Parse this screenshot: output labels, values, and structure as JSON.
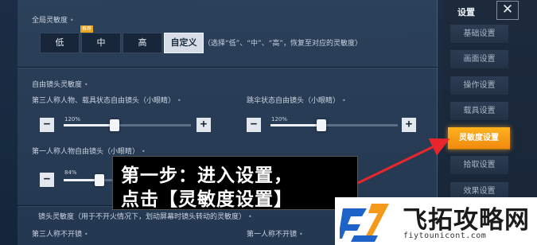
{
  "global_sensitivity": {
    "title": "全局灵敏度",
    "presets": [
      "低",
      "中",
      "高",
      "自定义"
    ],
    "recommend_badge": "推荐",
    "selected": "自定义",
    "note": "（选择“低”、“中”、“高”，恢复至对应的灵敏度）"
  },
  "free_look_sensitivity": {
    "title": "自由镜头灵敏度",
    "rows": [
      {
        "label": "第三人称人物、载具状态自由镜头（小眼睛）",
        "value_text": "120%",
        "value": 120
      },
      {
        "label": "跳伞状态自由镜头（小眼睛）",
        "value_text": "120%",
        "value": 120
      },
      {
        "label": "第一人称人物自由镜头（小眼睛）",
        "value_text": "84%",
        "value": 84
      }
    ]
  },
  "lens_sensitivity": {
    "title": "镜头灵敏度（用于不开火情况下，划动屏幕时镜头转动的灵敏度）",
    "items": [
      "第三人称不开镜",
      "第一人称不开镜"
    ]
  },
  "sidebar": {
    "title": "设置",
    "close_symbol": "✕",
    "items": [
      "基础设置",
      "画面设置",
      "操作设置",
      "载具设置",
      "灵敏度设置",
      "拾取设置",
      "效果设置"
    ],
    "active": "灵敏度设置"
  },
  "annotation": {
    "line1": "第一步：进入设置，",
    "line2": "点击【灵敏度设置】"
  },
  "watermark": {
    "name": "飞拓攻略网",
    "domain": "fiytounicont.com"
  },
  "colors": {
    "accent_orange": "#f5a11a",
    "annotation_arrow": "#e8262c",
    "panel_bg": "#2d425c"
  }
}
